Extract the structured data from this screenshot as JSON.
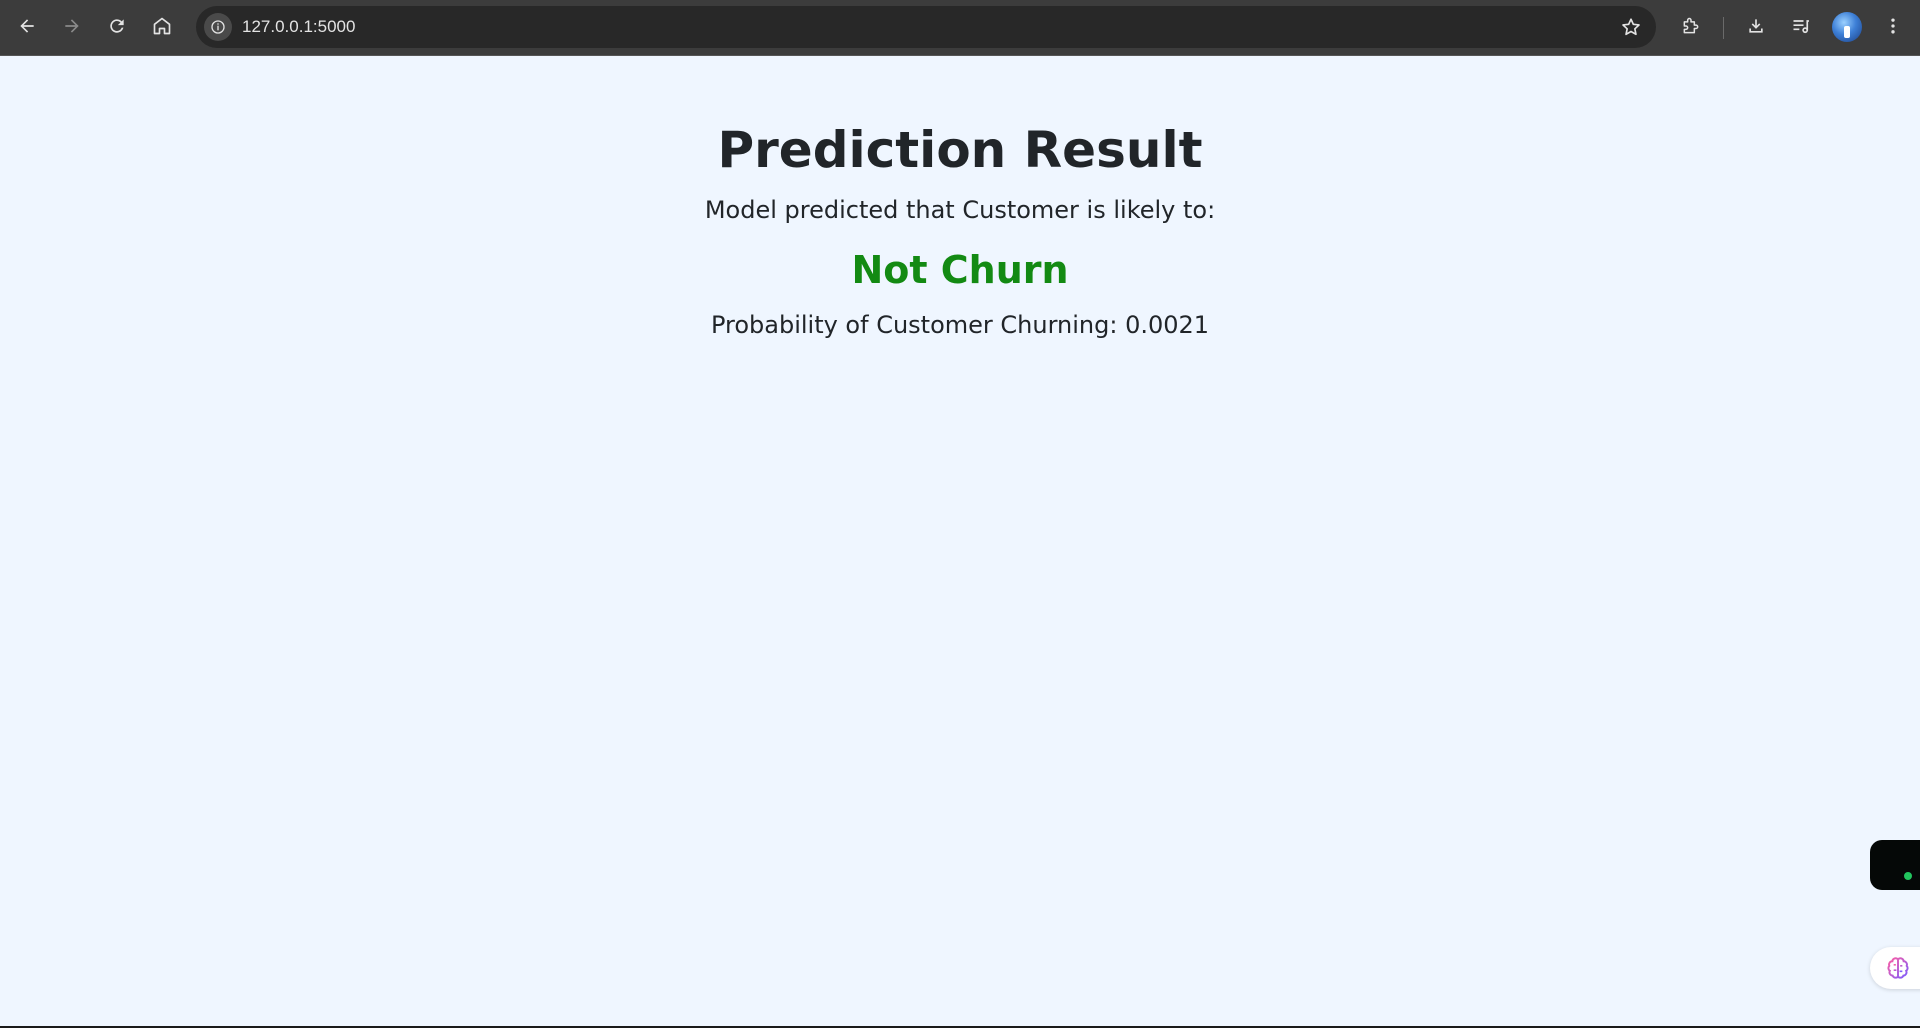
{
  "browser": {
    "url": "127.0.0.1:5000",
    "icons": [
      "back-icon",
      "forward-icon",
      "reload-icon",
      "home-icon",
      "site-info-icon",
      "star-icon",
      "extensions-icon",
      "download-icon",
      "reading-list-icon",
      "profile-avatar",
      "menu-icon"
    ]
  },
  "page": {
    "title": "Prediction Result",
    "subtitle": "Model predicted that Customer is likely to:",
    "prediction": "Not Churn",
    "probability_label": "Probability of Customer Churning: ",
    "probability_value": "0.0021"
  },
  "colors": {
    "background": "#eff6ff",
    "prediction_text": "#138a13",
    "heading_text": "#212529",
    "status_dot": "#22c55e"
  },
  "widgets": [
    "floating-panel-toggle",
    "brain-extension-icon"
  ]
}
